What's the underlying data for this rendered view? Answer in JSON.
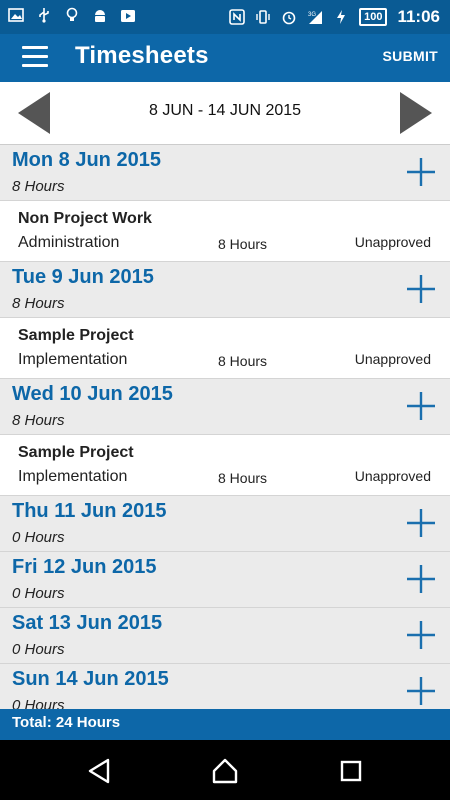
{
  "status_bar": {
    "time": "11:06",
    "network": "3G",
    "battery": "100",
    "left_icons": [
      "image-icon",
      "usb-icon",
      "bulb-icon",
      "android-icon",
      "play-store-icon"
    ],
    "right_icons": [
      "nfc-icon",
      "vibrate-icon",
      "alarm-icon",
      "signal-icon",
      "charging-icon"
    ]
  },
  "app_bar": {
    "title": "Timesheets",
    "submit_label": "SUBMIT"
  },
  "week_nav": {
    "label": "8 JUN - 14 JUN 2015"
  },
  "days": [
    {
      "title": "Mon 8 Jun 2015",
      "hours": "8 Hours",
      "entries": [
        {
          "project": "Non Project Work",
          "task": "Administration",
          "hours": "8 Hours",
          "status": "Unapproved"
        }
      ]
    },
    {
      "title": "Tue 9 Jun 2015",
      "hours": "8 Hours",
      "entries": [
        {
          "project": "Sample Project",
          "task": "Implementation",
          "hours": "8 Hours",
          "status": "Unapproved"
        }
      ]
    },
    {
      "title": "Wed 10 Jun 2015",
      "hours": "8 Hours",
      "entries": [
        {
          "project": "Sample Project",
          "task": "Implementation",
          "hours": "8 Hours",
          "status": "Unapproved"
        }
      ]
    },
    {
      "title": "Thu 11 Jun 2015",
      "hours": "0 Hours",
      "entries": []
    },
    {
      "title": "Fri 12 Jun 2015",
      "hours": "0 Hours",
      "entries": []
    },
    {
      "title": "Sat 13 Jun 2015",
      "hours": "0 Hours",
      "entries": []
    },
    {
      "title": "Sun 14 Jun 2015",
      "hours": "0 Hours",
      "entries": []
    }
  ],
  "total": {
    "label": "Total: 24 Hours"
  },
  "colors": {
    "primary": "#0d67a8",
    "status_bar": "#0a5b94",
    "day_header_bg": "#ebebeb"
  },
  "nav_bar": {
    "buttons": [
      "back-icon",
      "home-icon",
      "recents-icon"
    ]
  }
}
